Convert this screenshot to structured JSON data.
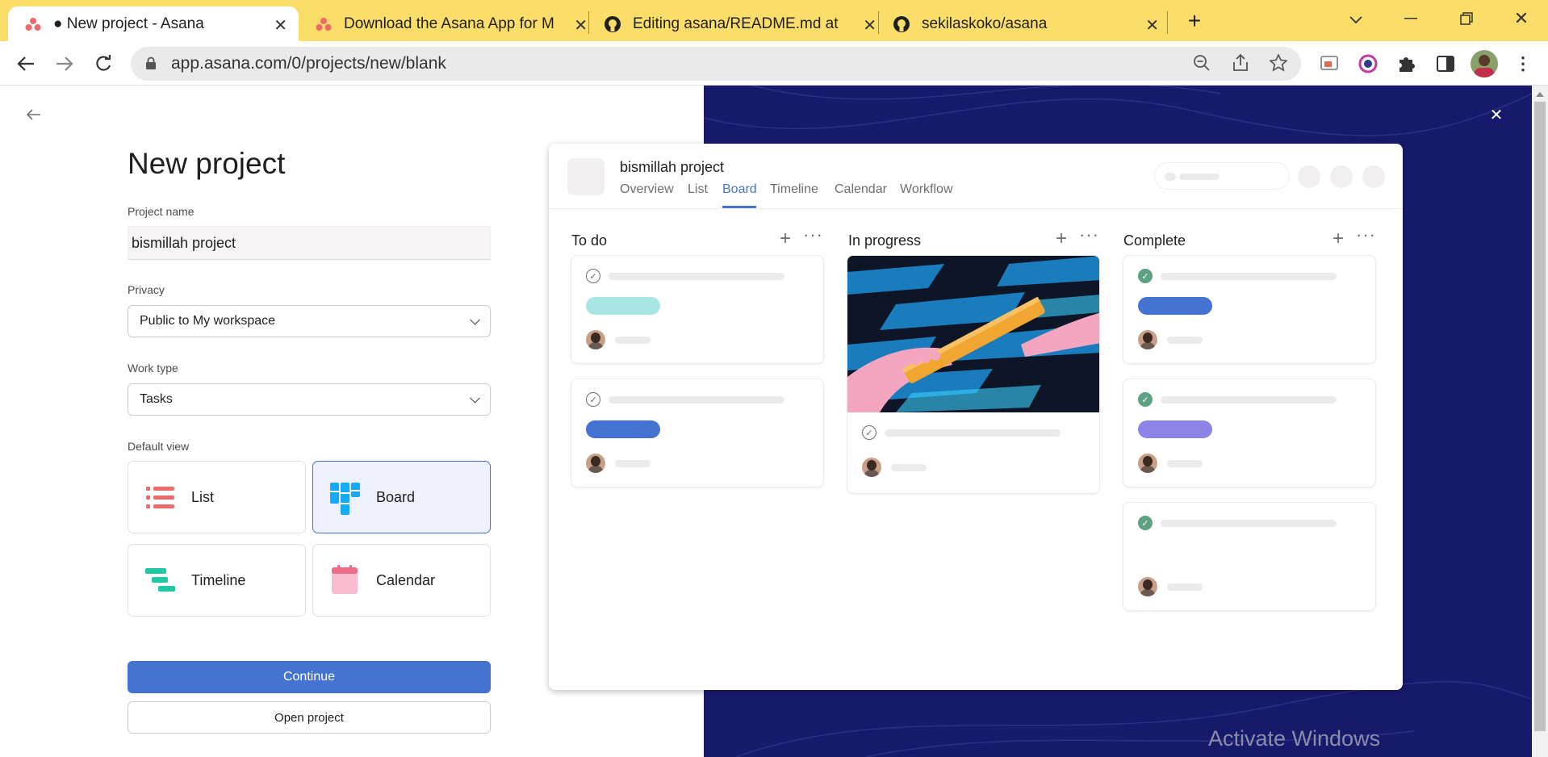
{
  "browser": {
    "tabs": [
      {
        "title": "● New project - Asana",
        "icon": "asana-icon"
      },
      {
        "title": "Download the Asana App for Mobile",
        "icon": "asana-icon"
      },
      {
        "title": "Editing asana/README.md at main",
        "icon": "github-icon"
      },
      {
        "title": "sekilaskoko/asana",
        "icon": "github-icon"
      }
    ],
    "url": "app.asana.com/0/projects/new/blank"
  },
  "form": {
    "heading": "New project",
    "project_name_label": "Project name",
    "project_name_value": "bismillah project",
    "privacy_label": "Privacy",
    "privacy_value": "Public to My workspace",
    "work_type_label": "Work type",
    "work_type_value": "Tasks",
    "default_view_label": "Default view",
    "views": [
      {
        "label": "List",
        "icon": "list-icon",
        "selected": false
      },
      {
        "label": "Board",
        "icon": "board-icon",
        "selected": true
      },
      {
        "label": "Timeline",
        "icon": "timeline-icon",
        "selected": false
      },
      {
        "label": "Calendar",
        "icon": "calendar-icon",
        "selected": false
      }
    ],
    "continue_label": "Continue",
    "open_project_label": "Open project"
  },
  "preview": {
    "project_title": "bismillah project",
    "tabs": [
      "Overview",
      "List",
      "Board",
      "Timeline",
      "Calendar",
      "Workflow"
    ],
    "active_tab": "Board",
    "columns": [
      {
        "name": "To do",
        "cards": [
          {
            "done": false,
            "pill": "#a8e6e3"
          },
          {
            "done": false,
            "pill": "#4573d2"
          }
        ]
      },
      {
        "name": "In progress",
        "cards": [
          {
            "done": false,
            "image": true
          }
        ]
      },
      {
        "name": "Complete",
        "cards": [
          {
            "done": true,
            "pill": "#4573d2"
          },
          {
            "done": true,
            "pill": "#8d84e8"
          },
          {
            "done": true
          }
        ]
      }
    ]
  },
  "watermark": "Activate Windows",
  "colors": {
    "tab_strip": "#fbdd6a",
    "primary_button": "#4573d2",
    "right_bg": "#17196b",
    "selected_card_bg": "#eef0fb"
  }
}
